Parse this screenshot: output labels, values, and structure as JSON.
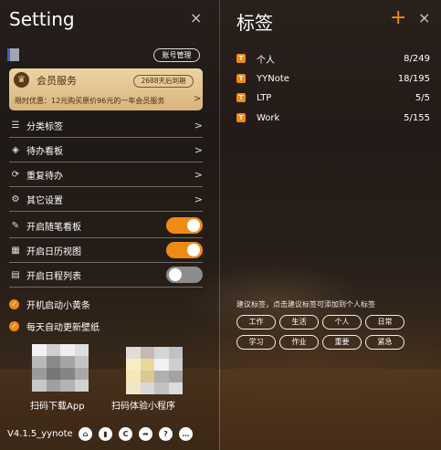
{
  "settings": {
    "title": "Setting",
    "close_icon": "×",
    "account_button": "账号管理",
    "member": {
      "title": "会员服务",
      "expiry": "2688天后到期",
      "promo": "限时优惠：12元购买原价96元的一年会员服务",
      "promo_chevron": ">"
    },
    "menu": [
      {
        "label": "分类标签",
        "icon": "list-icon",
        "glyph": "☰"
      },
      {
        "label": "待办看板",
        "icon": "layers-icon",
        "glyph": "◈"
      },
      {
        "label": "重复待办",
        "icon": "repeat-icon",
        "glyph": "⟳"
      },
      {
        "label": "其它设置",
        "icon": "gear-icon",
        "glyph": "⚙"
      }
    ],
    "toggles": [
      {
        "label": "开启随笔看板",
        "icon": "note-icon",
        "glyph": "✎",
        "on": true
      },
      {
        "label": "开启日历视图",
        "icon": "calendar-icon",
        "glyph": "▦",
        "on": true
      },
      {
        "label": "开启日程列表",
        "icon": "schedule-icon",
        "glyph": "▤",
        "on": false
      }
    ],
    "checks": [
      {
        "label": "开机启动小黄条",
        "checked": true
      },
      {
        "label": "每天自动更新壁纸",
        "checked": true
      }
    ],
    "qr": [
      {
        "caption": "扫码下载App"
      },
      {
        "caption": "扫码体验小程序"
      }
    ],
    "version": "V4.1.5_yynote",
    "footer_icons": [
      {
        "name": "home-icon",
        "glyph": "⌂"
      },
      {
        "name": "book-icon",
        "glyph": "▮"
      },
      {
        "name": "copyright-icon",
        "glyph": "C"
      },
      {
        "name": "share-icon",
        "glyph": "➦"
      },
      {
        "name": "help-icon",
        "glyph": "?"
      },
      {
        "name": "chat-icon",
        "glyph": "…"
      }
    ]
  },
  "tags": {
    "title": "标签",
    "add_icon": "+",
    "close_icon": "×",
    "items": [
      {
        "name": "个人",
        "count": "8/249"
      },
      {
        "name": "YYNote",
        "count": "18/195"
      },
      {
        "name": "LTP",
        "count": "5/5"
      },
      {
        "name": "Work",
        "count": "5/155"
      }
    ],
    "suggest_tip": "建议标签，点击建议标签可添加到个人标签",
    "suggestions": [
      "工作",
      "生活",
      "个人",
      "日常",
      "学习",
      "作业",
      "重要",
      "紧急"
    ]
  },
  "colors": {
    "accent": "#f08a16"
  }
}
